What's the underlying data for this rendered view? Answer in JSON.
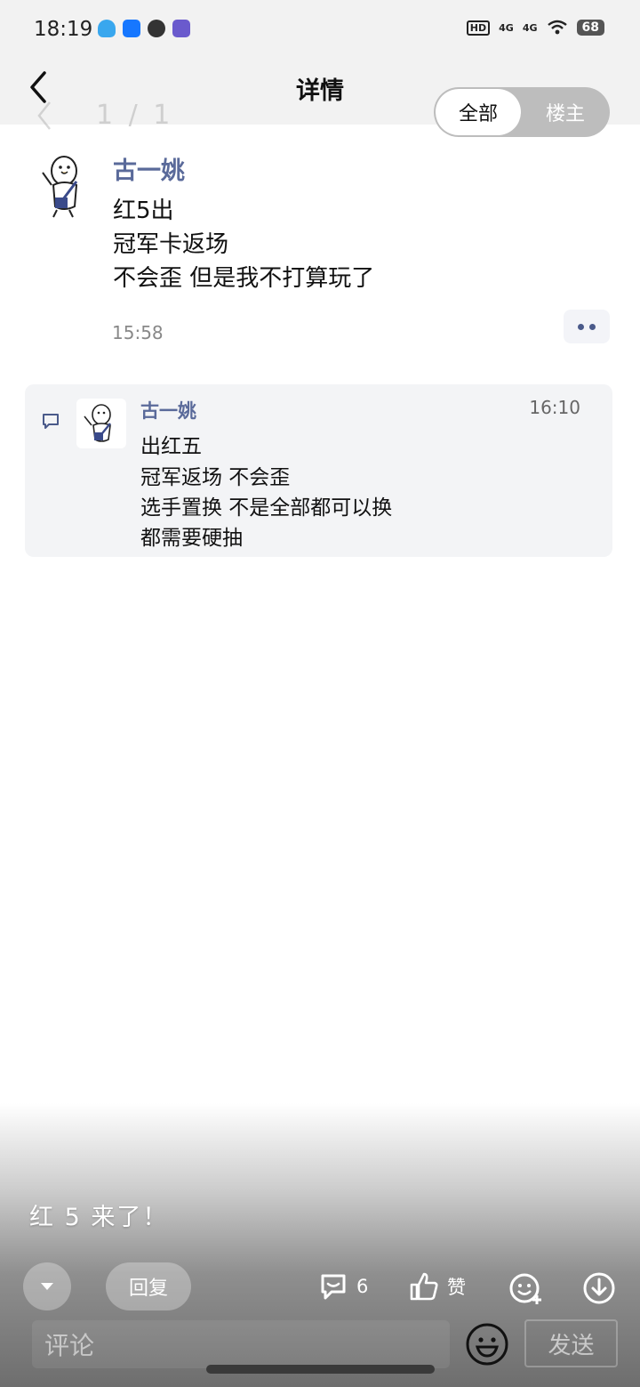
{
  "status_bar": {
    "time": "18:19",
    "hd_label": "HD",
    "network_1": "4G",
    "network_2": "4G",
    "battery": "68"
  },
  "header": {
    "title": "详情",
    "ghost_page": "1 / 1",
    "filter_options": [
      "全部",
      "楼主"
    ],
    "filter_selected": "全部"
  },
  "post": {
    "author": "古一姚",
    "lines": [
      "红5出",
      "冠军卡返场",
      "不会歪 但是我不打算玩了"
    ],
    "time": "15:58"
  },
  "reply": {
    "author": "古一姚",
    "time": "16:10",
    "lines": [
      "出红五",
      "冠军返场 不会歪",
      "选手置换 不是全部都可以换",
      "都需要硬抽"
    ]
  },
  "overlay": {
    "danmaku": "红 5 来了！",
    "reply_label": "回复",
    "comment_count": "6",
    "like_label": "赞"
  },
  "composer": {
    "placeholder": "评论",
    "send_label": "发送"
  },
  "colors": {
    "author_name": "#5a6a9a",
    "card_bg": "#f3f4f6",
    "header_bg": "#f2f2f2"
  }
}
